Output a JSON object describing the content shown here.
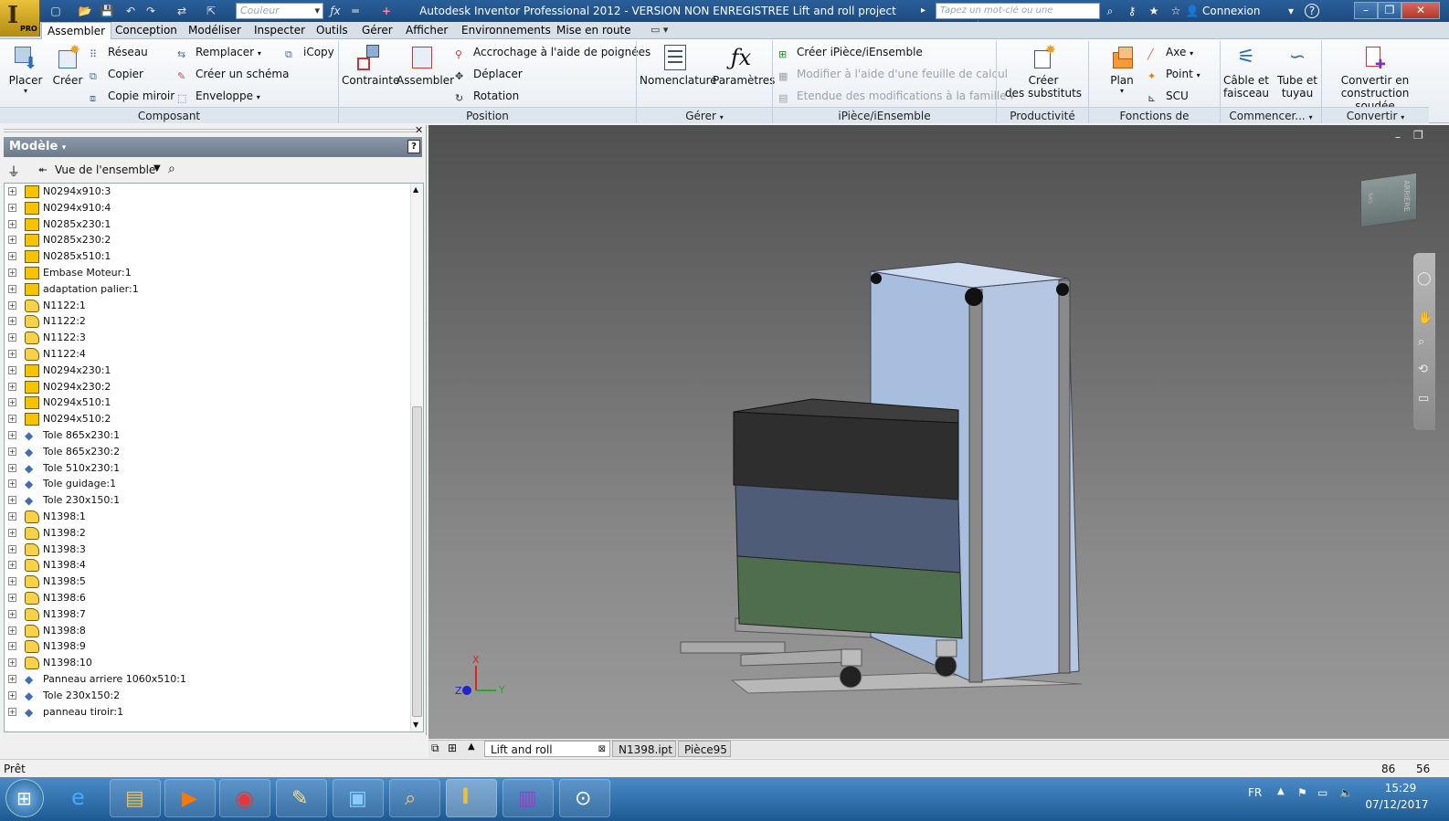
{
  "titlebar": {
    "title": "Autodesk Inventor Professional 2012 - VERSION NON ENREGISTREE    Lift and roll project",
    "color_placeholder": "Couleur",
    "search_placeholder": "Tapez un mot-clé ou une expression",
    "login": "Connexion",
    "logo_pro": "PRO"
  },
  "tabs": [
    "Assembler",
    "Conception",
    "Modéliser",
    "Inspecter",
    "Outils",
    "Gérer",
    "Afficher",
    "Environnements",
    "Mise en route"
  ],
  "ribbon": {
    "composant": {
      "label": "Composant",
      "placer": "Placer",
      "creer": "Créer",
      "reseau": "Réseau",
      "copier": "Copier",
      "copie_miroir": "Copie miroir",
      "remplacer": "Remplacer",
      "creer_schema": "Créer un schéma",
      "enveloppe": "Enveloppe",
      "icopy": "iCopy"
    },
    "position": {
      "label": "Position",
      "contrainte": "Contrainte",
      "assembler": "Assembler",
      "accrochage": "Accrochage à l'aide de poignées",
      "deplacer": "Déplacer",
      "rotation": "Rotation"
    },
    "gerer": {
      "label": "Gérer",
      "nomenclature": "Nomenclature",
      "parametres": "Paramètres"
    },
    "ipiece": {
      "label": "iPièce/iEnsemble",
      "creer": "Créer iPièce/iEnsemble",
      "modifier": "Modifier à l'aide d'une feuille de calcul",
      "etendue": "Etendue des modifications à la famille"
    },
    "productivite": {
      "label": "Productivité",
      "creer_substituts_1": "Créer",
      "creer_substituts_2": "des substituts"
    },
    "fonctions": {
      "label": "Fonctions de construction",
      "plan": "Plan",
      "axe": "Axe",
      "point": "Point",
      "scu": "SCU"
    },
    "commencer": {
      "label": "Commencer...",
      "cable_1": "Câble et",
      "cable_2": "faisceau",
      "tube_1": "Tube et",
      "tube_2": "tuyau"
    },
    "convertir": {
      "label": "Convertir",
      "conv_1": "Convertir en",
      "conv_2": "construction soudée"
    }
  },
  "browser": {
    "title": "Modèle",
    "view": "Vue de l'ensemble",
    "items": [
      {
        "name": "N0294x910:3",
        "type": "part"
      },
      {
        "name": "N0294x910:4",
        "type": "part"
      },
      {
        "name": "N0285x230:1",
        "type": "part"
      },
      {
        "name": "N0285x230:2",
        "type": "part"
      },
      {
        "name": "N0285x510:1",
        "type": "part"
      },
      {
        "name": "Embase Moteur:1",
        "type": "part"
      },
      {
        "name": "adaptation palier:1",
        "type": "part"
      },
      {
        "name": "N1122:1",
        "type": "cc"
      },
      {
        "name": "N1122:2",
        "type": "cc"
      },
      {
        "name": "N1122:3",
        "type": "cc"
      },
      {
        "name": "N1122:4",
        "type": "cc"
      },
      {
        "name": "N0294x230:1",
        "type": "part"
      },
      {
        "name": "N0294x230:2",
        "type": "part"
      },
      {
        "name": "N0294x510:1",
        "type": "part"
      },
      {
        "name": "N0294x510:2",
        "type": "part"
      },
      {
        "name": "Tole 865x230:1",
        "type": "sheet"
      },
      {
        "name": "Tole 865x230:2",
        "type": "sheet"
      },
      {
        "name": "Tole 510x230:1",
        "type": "sheet"
      },
      {
        "name": "Tole guidage:1",
        "type": "sheet"
      },
      {
        "name": "Tole 230x150:1",
        "type": "sheet"
      },
      {
        "name": "N1398:1",
        "type": "cc"
      },
      {
        "name": "N1398:2",
        "type": "cc"
      },
      {
        "name": "N1398:3",
        "type": "cc"
      },
      {
        "name": "N1398:4",
        "type": "cc"
      },
      {
        "name": "N1398:5",
        "type": "cc"
      },
      {
        "name": "N1398:6",
        "type": "cc"
      },
      {
        "name": "N1398:7",
        "type": "cc"
      },
      {
        "name": "N1398:8",
        "type": "cc"
      },
      {
        "name": "N1398:9",
        "type": "cc"
      },
      {
        "name": "N1398:10",
        "type": "cc"
      },
      {
        "name": "Panneau arriere 1060x510:1",
        "type": "sheet"
      },
      {
        "name": "Tole 230x150:2",
        "type": "sheet"
      },
      {
        "name": "panneau tiroir:1",
        "type": "sheet"
      }
    ]
  },
  "viewcube": {
    "face": "ARRIÈRE",
    "bottom": "BAS"
  },
  "axes": {
    "x": "X",
    "y": "Y",
    "z": "Z"
  },
  "doc_tabs": [
    "Lift and roll proj...iam",
    "N1398.ipt",
    "Pièce95"
  ],
  "status": {
    "text": "Prêt",
    "n1": "86",
    "n2": "56"
  },
  "taskbar": {
    "lang": "FR",
    "time": "15:29",
    "date": "07/12/2017"
  }
}
